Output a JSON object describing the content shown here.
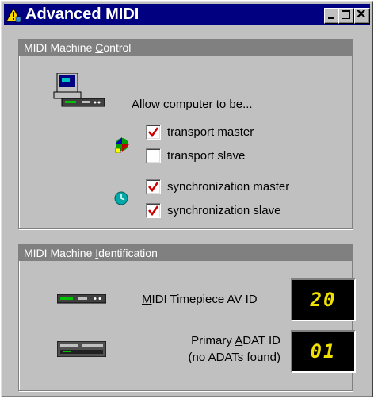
{
  "window": {
    "title": "Advanced MIDI",
    "buttons": [
      "minimize",
      "maximize",
      "close"
    ]
  },
  "mmc": {
    "group_title_pre": "MIDI Machine ",
    "group_title_accel": "C",
    "group_title_post": "ontrol",
    "prompt": "Allow computer to be...",
    "options": [
      {
        "label": "transport master",
        "checked": true
      },
      {
        "label": "transport slave",
        "checked": false
      },
      {
        "label": "synchronization master",
        "checked": true
      },
      {
        "label": "synchronization slave",
        "checked": true
      }
    ]
  },
  "mmi": {
    "group_title_pre": "MIDI Machine ",
    "group_title_accel": "I",
    "group_title_post": "dentification",
    "timepiece": {
      "label_accel": "M",
      "label_rest": "IDI Timepiece AV ID",
      "value": "20"
    },
    "adat": {
      "label_pre": "Primary ",
      "label_accel": "A",
      "label_rest": "DAT ID",
      "sub": "(no ADATs found)",
      "value": "01"
    }
  },
  "colors": {
    "titlebar": "#000080",
    "face": "#c0c0c0",
    "check": "#cc0000",
    "lcd_text": "#f0e000"
  }
}
